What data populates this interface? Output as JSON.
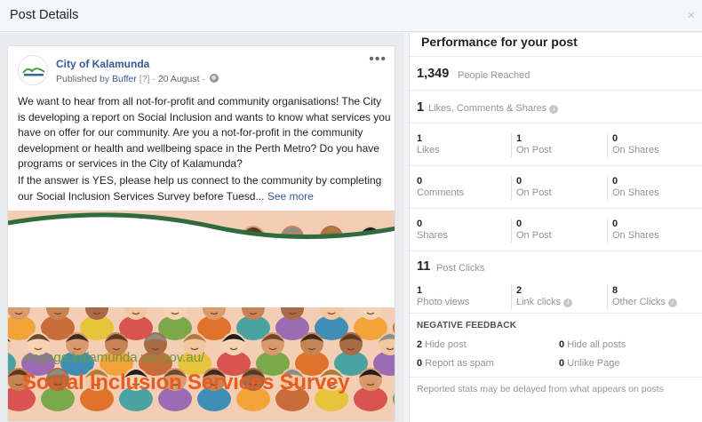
{
  "dialog": {
    "title": "Post Details",
    "close_glyph": "×"
  },
  "post": {
    "page_name": "City of Kalamunda",
    "published_by_prefix": "Published by",
    "published_by": "Buffer",
    "help_marker": "[?]",
    "date": "· 20 August ·",
    "text_p1": "We want to hear from all not-for-profit and community organisations! The City is developing a report on Social Inclusion and wants to know what services you have on offer for our community. Are you a not-for-profit in the community development or health and wellbeing space in the Perth Metro? Do you have programs or services in the City of Kalamunda?",
    "text_p2": "If the answer is YES, please help us connect to the community by completing our Social Inclusion Services Survey before Tuesd...",
    "see_more": "See more",
    "image_url_text": "engage.kalamunda.wa.gov.au/",
    "image_title": "Social Inclusion Services Survey",
    "avatar_text": "Kalamunda",
    "more_glyph": "•••"
  },
  "performance": {
    "title": "Performance for your post",
    "reached": {
      "value": "1,349",
      "label": "People Reached"
    },
    "engagement": {
      "value": "1",
      "label": "Likes, Comments & Shares"
    },
    "grid": [
      {
        "cells": [
          {
            "num": "1",
            "lbl": "Likes"
          },
          {
            "num": "1",
            "lbl": "On Post"
          },
          {
            "num": "0",
            "lbl": "On Shares"
          }
        ]
      },
      {
        "cells": [
          {
            "num": "0",
            "lbl": "Comments"
          },
          {
            "num": "0",
            "lbl": "On Post"
          },
          {
            "num": "0",
            "lbl": "On Shares"
          }
        ]
      },
      {
        "cells": [
          {
            "num": "0",
            "lbl": "Shares"
          },
          {
            "num": "0",
            "lbl": "On Post"
          },
          {
            "num": "0",
            "lbl": "On Shares"
          }
        ]
      }
    ],
    "clicks": {
      "value": "11",
      "label": "Post Clicks"
    },
    "click_breakdown": [
      {
        "num": "1",
        "lbl": "Photo views"
      },
      {
        "num": "2",
        "lbl": "Link clicks"
      },
      {
        "num": "8",
        "lbl": "Other Clicks"
      }
    ],
    "negative": {
      "title": "NEGATIVE FEEDBACK",
      "hide_post": {
        "num": "2",
        "lbl": "Hide post"
      },
      "hide_all": {
        "num": "0",
        "lbl": "Hide all posts"
      },
      "spam": {
        "num": "0",
        "lbl": "Report as spam"
      },
      "unlike": {
        "num": "0",
        "lbl": "Unlike Page"
      }
    },
    "footer_note": "Reported stats may be delayed from what appears on posts",
    "info_glyph": "i"
  },
  "colors": {
    "link": "#385898",
    "survey_orange": "#e85b21",
    "url_green": "#6a9a43"
  }
}
